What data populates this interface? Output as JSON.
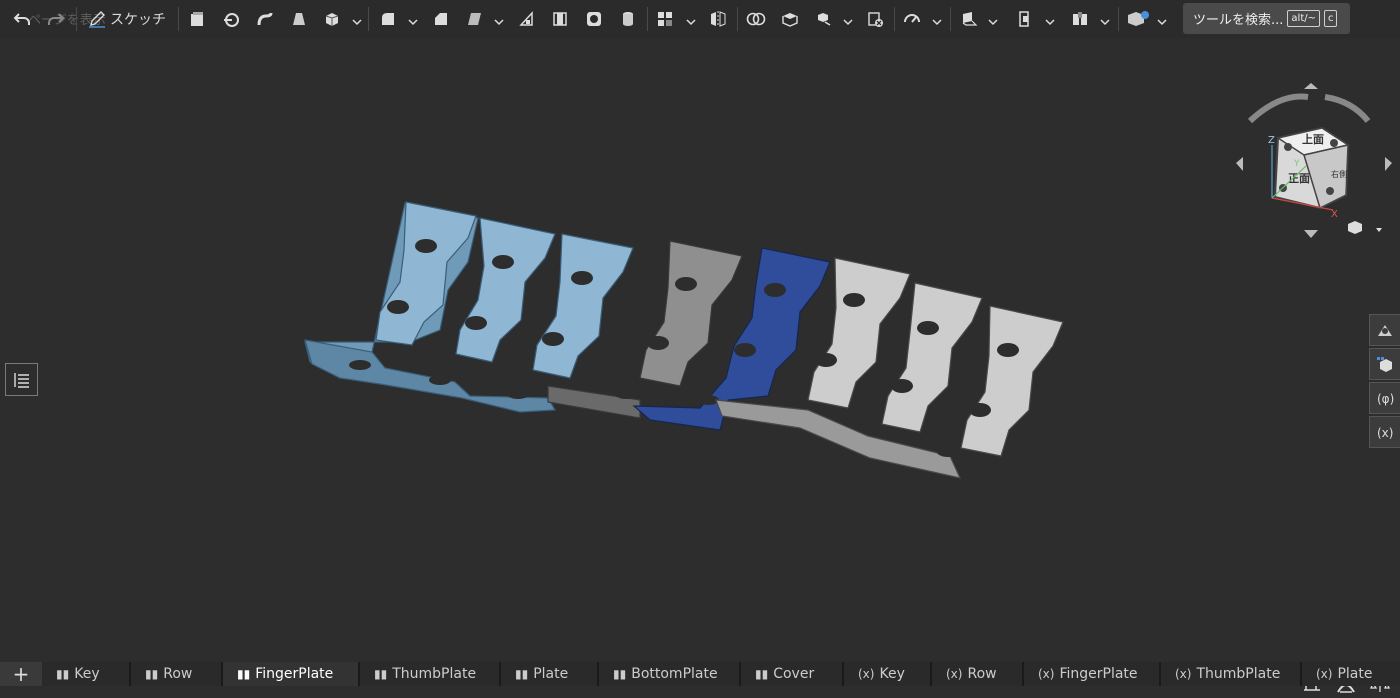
{
  "toolbar": {
    "sketch_label": "スケッチ",
    "search_label": "ツールを検索...",
    "search_shortcut_1": "alt/~",
    "search_shortcut_2": "c",
    "ghost_text": "ページを表示"
  },
  "viewcube": {
    "top": "上面",
    "front": "正面",
    "right": "右側",
    "axis_z": "Z",
    "axis_y": "Y",
    "axis_x": "X"
  },
  "tabs": [
    {
      "label": "Key",
      "icon": "component-icon",
      "active": false
    },
    {
      "label": "Row",
      "icon": "component-icon",
      "active": false
    },
    {
      "label": "FingerPlate",
      "icon": "component-icon",
      "active": true
    },
    {
      "label": "ThumbPlate",
      "icon": "component-icon",
      "active": false
    },
    {
      "label": "Plate",
      "icon": "component-icon",
      "active": false
    },
    {
      "label": "BottomPlate",
      "icon": "component-icon",
      "active": false
    },
    {
      "label": "Cover",
      "icon": "component-icon",
      "active": false
    },
    {
      "label": "Key",
      "icon": "parameter-icon",
      "active": false
    },
    {
      "label": "Row",
      "icon": "parameter-icon",
      "active": false
    },
    {
      "label": "FingerPlate",
      "icon": "parameter-icon",
      "active": false
    },
    {
      "label": "ThumbPlate",
      "icon": "parameter-icon",
      "active": false
    },
    {
      "label": "Plate",
      "icon": "parameter-icon",
      "active": false
    }
  ],
  "colors": {
    "light_blue": "#8fb3cf",
    "dark_blue": "#2e4a93",
    "gray": "#8a8a8a",
    "white": "#c8c8c8",
    "background": "#2d2d2d"
  }
}
